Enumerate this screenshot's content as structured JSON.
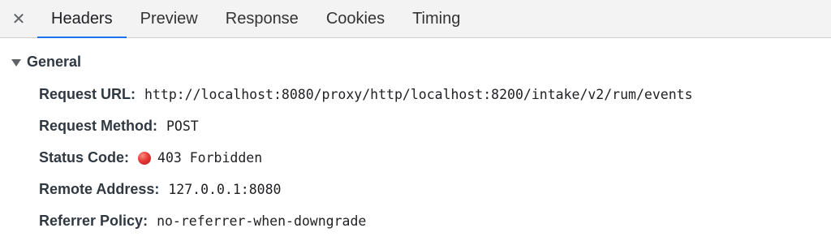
{
  "toolbar": {
    "close_glyph": "✕",
    "tabs": [
      {
        "label": "Headers",
        "active": true
      },
      {
        "label": "Preview",
        "active": false
      },
      {
        "label": "Response",
        "active": false
      },
      {
        "label": "Cookies",
        "active": false
      },
      {
        "label": "Timing",
        "active": false
      }
    ]
  },
  "general": {
    "title": "General",
    "rows": [
      {
        "key": "Request URL:",
        "value": "http://localhost:8080/proxy/http/localhost:8200/intake/v2/rum/events"
      },
      {
        "key": "Request Method:",
        "value": "POST"
      },
      {
        "key": "Status Code:",
        "value": "403 Forbidden",
        "status_color": "#e53935"
      },
      {
        "key": "Remote Address:",
        "value": "127.0.0.1:8080"
      },
      {
        "key": "Referrer Policy:",
        "value": "no-referrer-when-downgrade"
      }
    ]
  },
  "colors": {
    "accent": "#1a73e8",
    "status_error": "#e53935"
  },
  "icons": [
    "close-icon",
    "collapse-triangle-icon",
    "status-error-dot-icon"
  ]
}
